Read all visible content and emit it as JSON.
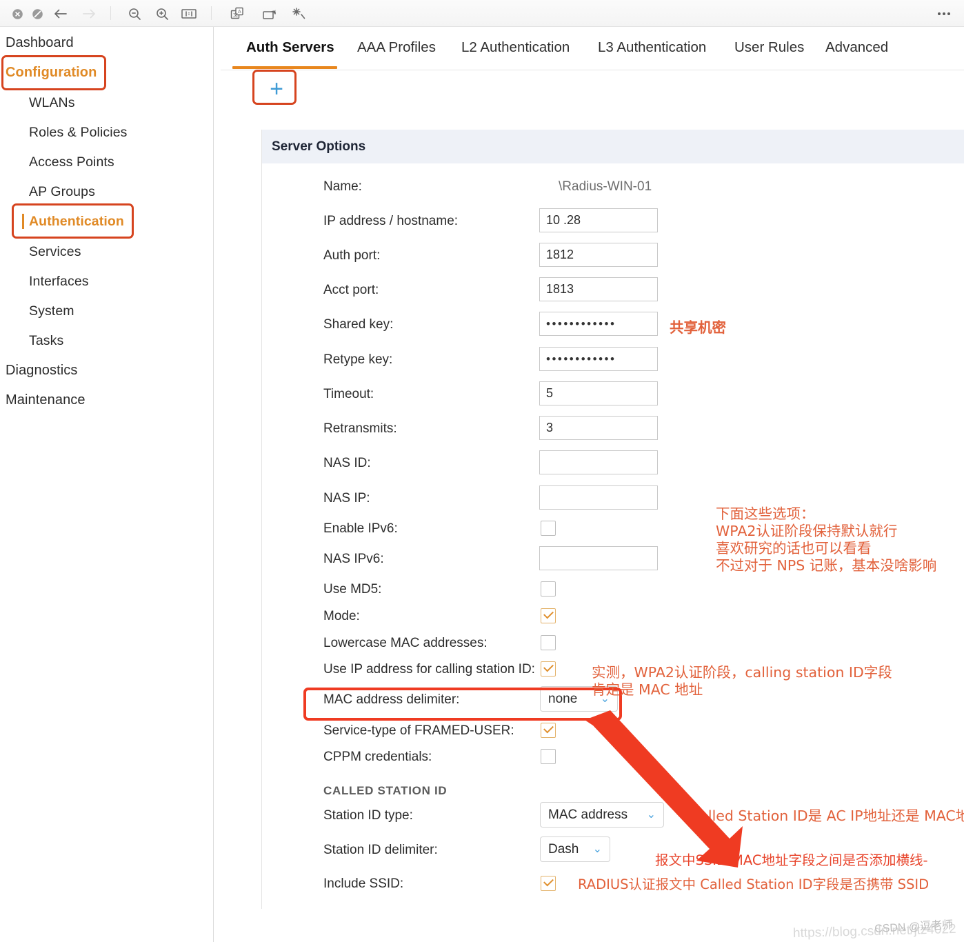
{
  "toolbar": {
    "icons": [
      {
        "name": "close-circle-icon",
        "glyph": "close"
      },
      {
        "name": "block-circle-icon",
        "glyph": "block"
      },
      {
        "name": "back-arrow-icon",
        "glyph": "back"
      },
      {
        "name": "forward-arrow-icon",
        "glyph": "forward"
      },
      {
        "name": "zoom-out-icon",
        "glyph": "zoom-out"
      },
      {
        "name": "zoom-in-icon",
        "glyph": "zoom-in"
      },
      {
        "name": "actual-size-icon",
        "glyph": "one-to-one"
      },
      {
        "name": "translate-icon",
        "glyph": "translate"
      },
      {
        "name": "rotate-icon",
        "glyph": "rotate"
      },
      {
        "name": "enhance-icon",
        "glyph": "sparkle"
      }
    ],
    "more_label": "more-options"
  },
  "sidebar": {
    "items": [
      {
        "label": "Dashboard",
        "level": "top",
        "highlighted": false
      },
      {
        "label": "Configuration",
        "level": "top",
        "highlighted": true
      },
      {
        "label": "WLANs",
        "level": "sub",
        "highlighted": false
      },
      {
        "label": "Roles & Policies",
        "level": "sub",
        "highlighted": false
      },
      {
        "label": "Access Points",
        "level": "sub",
        "highlighted": false
      },
      {
        "label": "AP Groups",
        "level": "sub",
        "highlighted": false
      },
      {
        "label": "Authentication",
        "level": "sub",
        "highlighted": true
      },
      {
        "label": "Services",
        "level": "sub",
        "highlighted": false
      },
      {
        "label": "Interfaces",
        "level": "sub",
        "highlighted": false
      },
      {
        "label": "System",
        "level": "sub",
        "highlighted": false
      },
      {
        "label": "Tasks",
        "level": "sub",
        "highlighted": false
      },
      {
        "label": "Diagnostics",
        "level": "top",
        "highlighted": false
      },
      {
        "label": "Maintenance",
        "level": "top",
        "highlighted": false
      }
    ]
  },
  "tabs": [
    {
      "label": "Auth Servers",
      "active": true
    },
    {
      "label": "AAA Profiles",
      "active": false
    },
    {
      "label": "L2 Authentication",
      "active": false
    },
    {
      "label": "L3 Authentication",
      "active": false
    },
    {
      "label": "User Rules",
      "active": false
    },
    {
      "label": "Advanced",
      "active": false
    }
  ],
  "add_button": {
    "label": "+"
  },
  "panel": {
    "title": "Server Options",
    "fields": [
      {
        "label": "Name:",
        "type": "readonly",
        "value": "\\Radius-WIN-01"
      },
      {
        "label": "IP address / hostname:",
        "type": "text",
        "value": "10      .28"
      },
      {
        "label": "Auth port:",
        "type": "text",
        "value": "1812"
      },
      {
        "label": "Acct port:",
        "type": "text",
        "value": "1813"
      },
      {
        "label": "Shared key:",
        "type": "password",
        "value": "••••••••••••"
      },
      {
        "label": "Retype key:",
        "type": "password",
        "value": "••••••••••••"
      },
      {
        "label": "Timeout:",
        "type": "text",
        "value": "5"
      },
      {
        "label": "Retransmits:",
        "type": "text",
        "value": "3"
      },
      {
        "label": "NAS ID:",
        "type": "text",
        "value": ""
      },
      {
        "label": "NAS IP:",
        "type": "text",
        "value": ""
      },
      {
        "label": "Enable IPv6:",
        "type": "checkbox",
        "checked": false
      },
      {
        "label": "NAS IPv6:",
        "type": "text",
        "value": ""
      },
      {
        "label": "Use MD5:",
        "type": "checkbox",
        "checked": false
      },
      {
        "label": "Mode:",
        "type": "checkbox",
        "checked": true
      },
      {
        "label": "Lowercase MAC addresses:",
        "type": "checkbox",
        "checked": false
      },
      {
        "label": "Use IP address for calling station ID:",
        "type": "checkbox",
        "checked": true
      },
      {
        "label": "MAC address delimiter:",
        "type": "select",
        "value": "none"
      },
      {
        "label": "Service-type of FRAMED-USER:",
        "type": "checkbox",
        "checked": true
      },
      {
        "label": "CPPM credentials:",
        "type": "checkbox",
        "checked": false
      }
    ],
    "called_station_id": {
      "section_label": "CALLED STATION ID",
      "fields": [
        {
          "label": "Station ID type:",
          "type": "select",
          "value": "MAC address"
        },
        {
          "label": "Station ID delimiter:",
          "type": "select",
          "value": "Dash"
        },
        {
          "label": "Include SSID:",
          "type": "checkbox",
          "checked": true
        }
      ]
    }
  },
  "annotations": {
    "shared_key": "共享机密",
    "defaults_block_line1": "下面这些选项：",
    "defaults_block_line2": "WPA2认证阶段保持默认就行",
    "defaults_block_line3": "喜欢研究的话也可以看看",
    "defaults_block_line4": "不过对于 NPS 记账，基本没啥影响",
    "calling_station_line1": "实测，WPA2认证阶段，calling station ID字段",
    "calling_station_line2": "肯定是 MAC 地址",
    "station_id_type": "Called Station ID是 AC IP地址还是 MAC地址",
    "station_id_delimiter": "报文中SSID-MAC地址字段之间是否添加横线-",
    "include_ssid": "RADIUS认证报文中 Called Station ID字段是否携带 SSID"
  },
  "watermark": {
    "url": "https://blog.csdn.net/jtz4022",
    "tag": "CSDN @逗老师"
  },
  "colors": {
    "accent_orange": "#e8871e",
    "annotation_red": "#e2623c",
    "annotation_red_strong": "#e8452c",
    "box_red": "#d6441f",
    "plus_blue": "#3e9bd5",
    "panel_header_bg": "#eef1f7"
  }
}
